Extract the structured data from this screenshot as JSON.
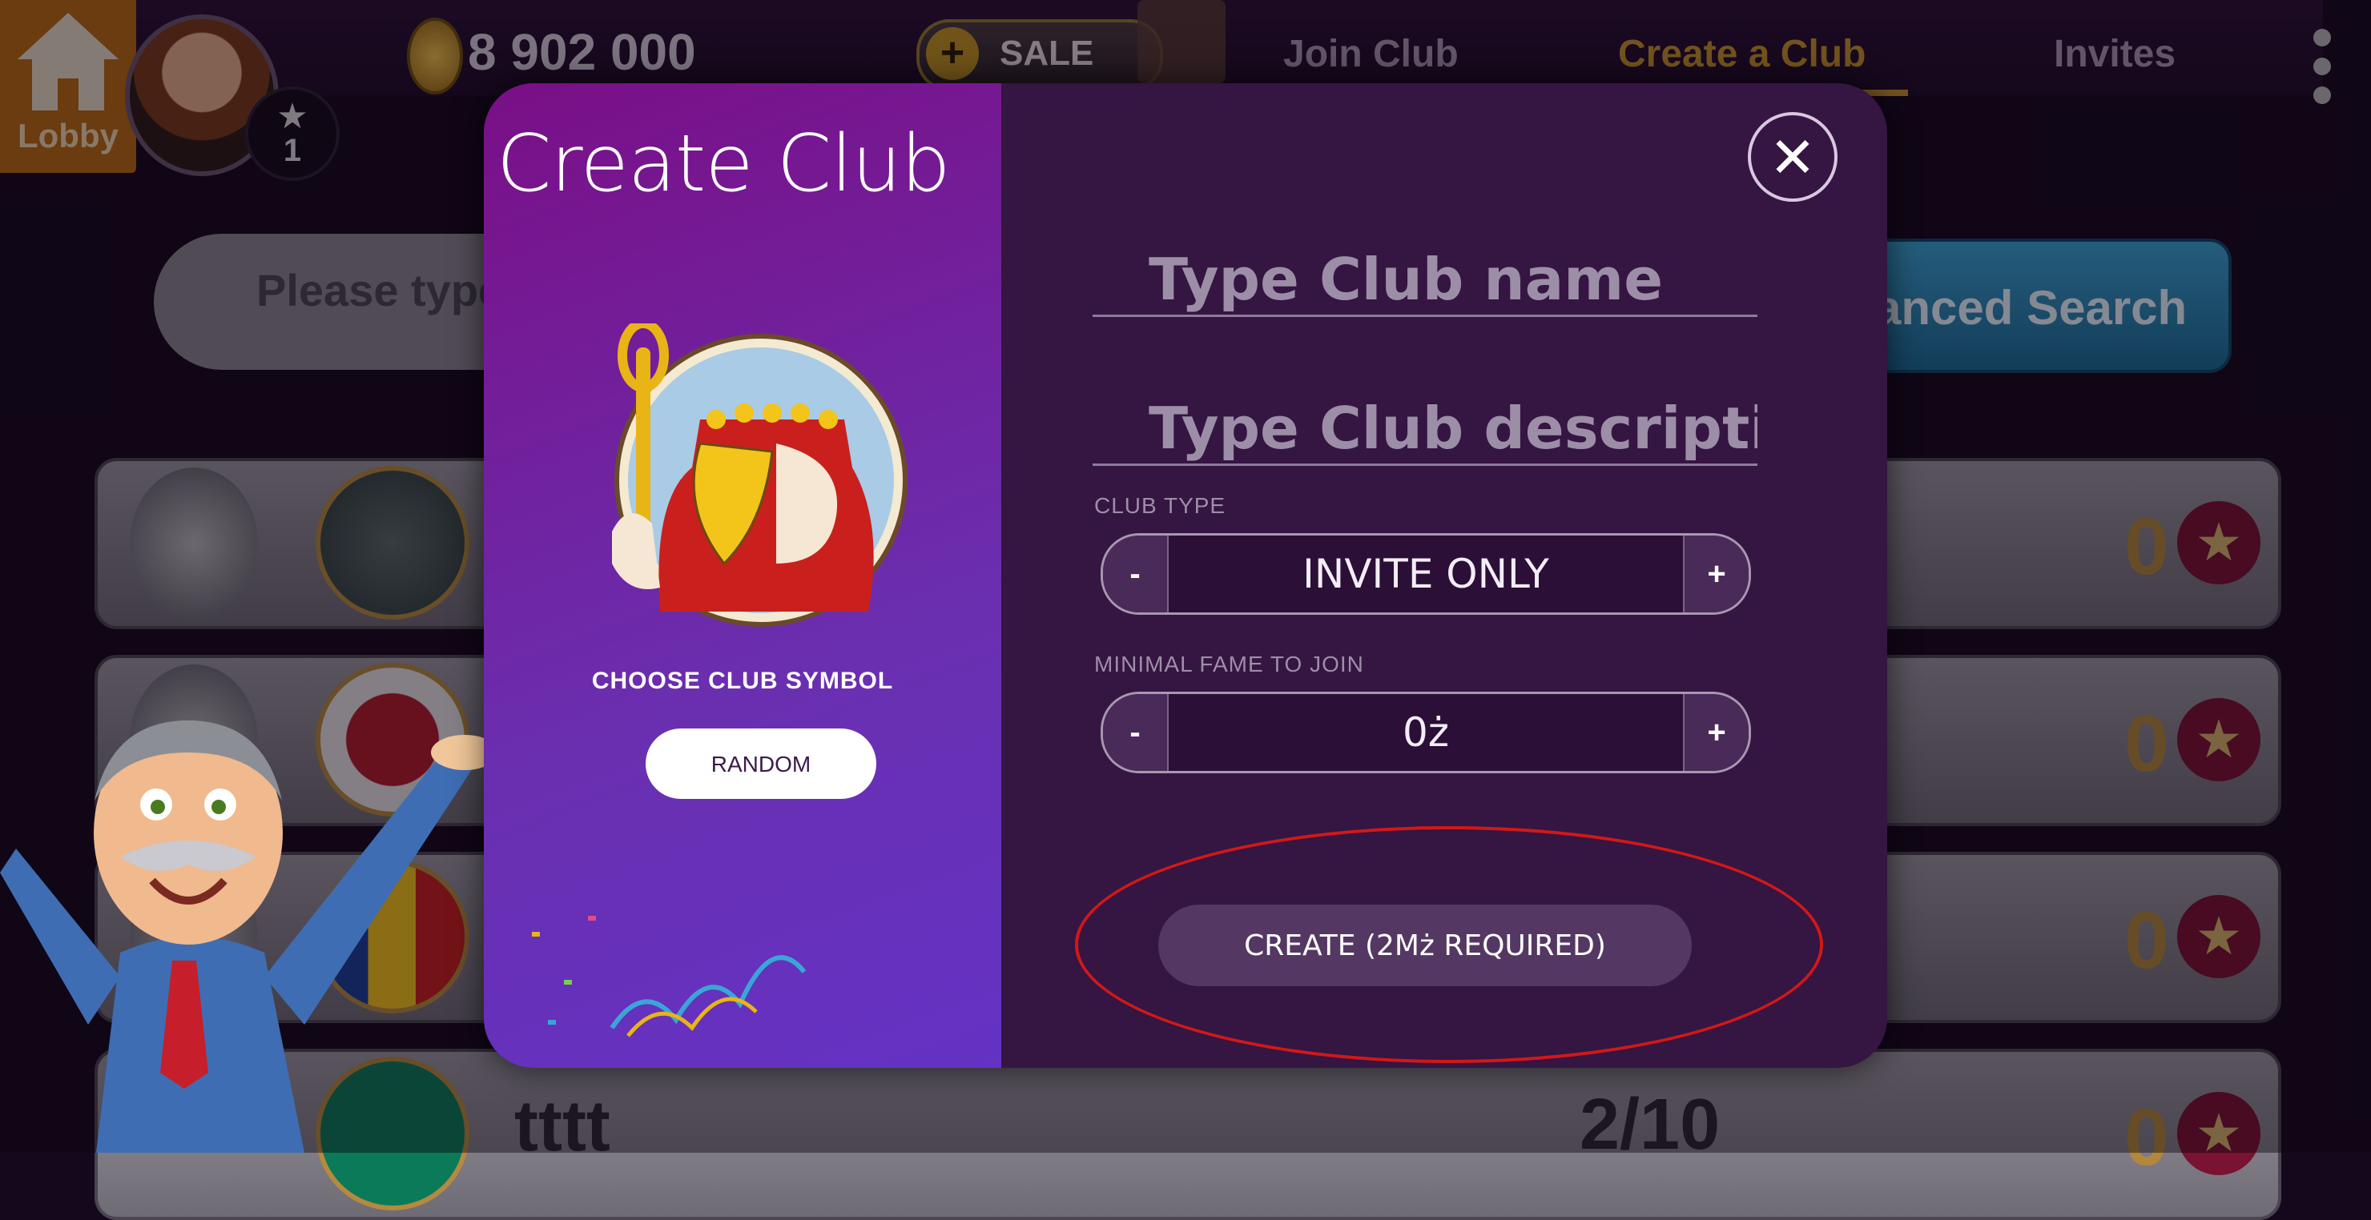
{
  "topbar": {
    "lobby_label": "Lobby",
    "level": "1",
    "coins": "8 902 000",
    "sale_plus": "+",
    "sale_label": "SALE",
    "tabs": [
      {
        "label": "Join Club"
      },
      {
        "label": "Create a Club",
        "active": true
      },
      {
        "label": "Invites"
      }
    ]
  },
  "background": {
    "search_placeholder": "Please type",
    "advanced_search": "anced Search",
    "rows": [
      {
        "count": "0"
      },
      {
        "count": "0"
      },
      {
        "count": "0"
      },
      {
        "name": "tttt",
        "members": "2/10",
        "count": "0"
      }
    ]
  },
  "modal": {
    "title": "Create Club",
    "choose_symbol_label": "CHOOSE CLUB SYMBOL",
    "random_label": "RANDOM",
    "close_glyph": "✕",
    "name_placeholder": "Type Club name",
    "description_placeholder": "Type Club description",
    "club_type_label": "CLUB TYPE",
    "club_type_value": "INVITE ONLY",
    "fame_label": "MINIMAL FAME TO JOIN",
    "fame_value": "0ż",
    "minus": "-",
    "plus": "+",
    "create_label": "CREATE (2Mż REQUIRED)"
  },
  "colors": {
    "accent_gold": "#c89428",
    "modal_bg": "#351541",
    "left_panel": "#6a2fb0",
    "highlight_red": "#d21818"
  },
  "icons": {
    "lobby": "house-icon",
    "level": "star-icon",
    "coin": "coin-icon",
    "close": "close-icon",
    "menu": "vertical-dots-icon"
  }
}
